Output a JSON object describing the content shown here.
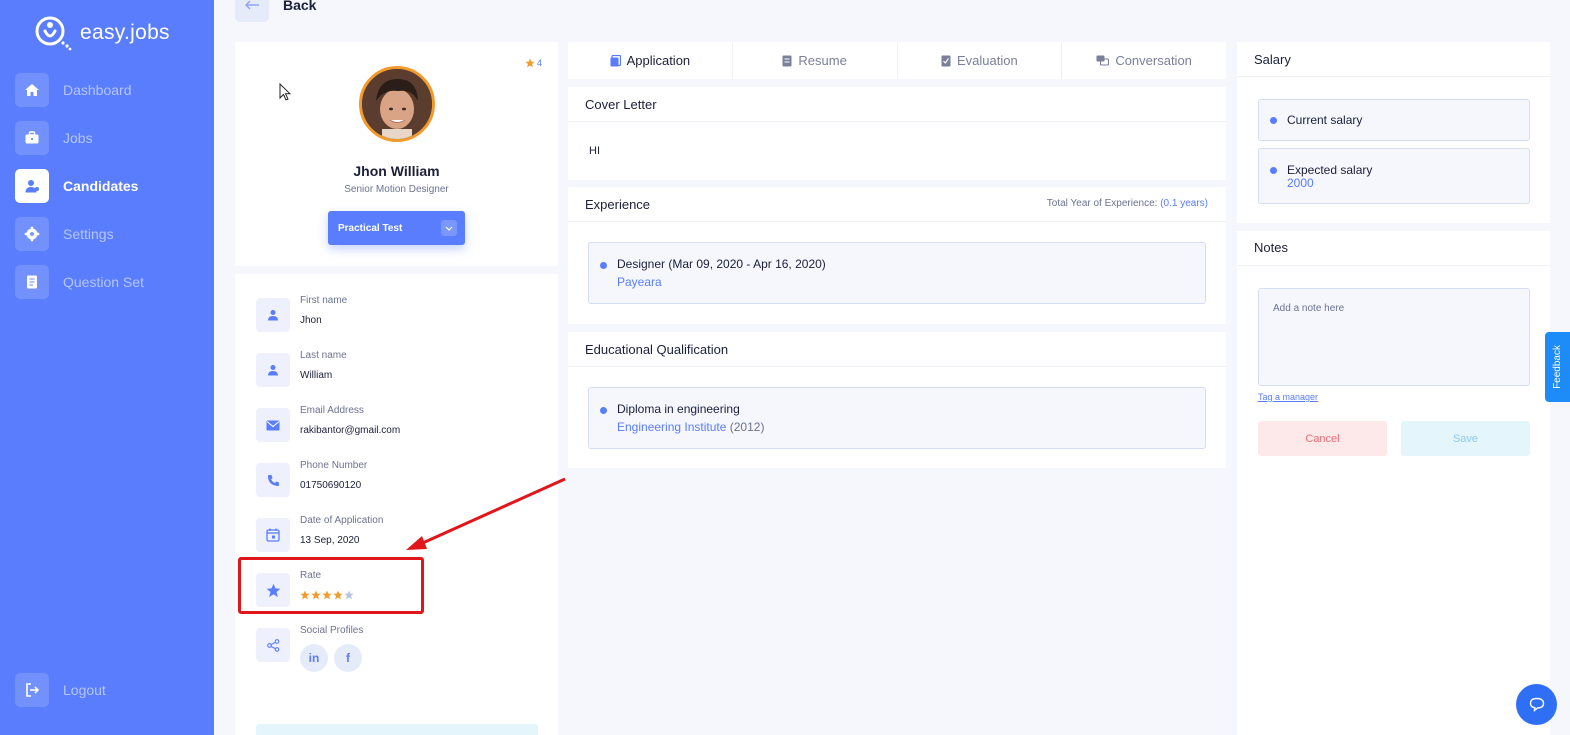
{
  "app": {
    "logo_text": "easy.jobs"
  },
  "sidebar": {
    "items": [
      {
        "label": "Dashboard",
        "icon": "home-icon"
      },
      {
        "label": "Jobs",
        "icon": "briefcase-icon"
      },
      {
        "label": "Candidates",
        "icon": "user-icon",
        "active": true
      },
      {
        "label": "Settings",
        "icon": "gear-icon"
      },
      {
        "label": "Question Set",
        "icon": "document-icon"
      }
    ],
    "logout_label": "Logout"
  },
  "topbar": {
    "back_label": "Back"
  },
  "candidate": {
    "rating_count": "4",
    "name": "Jhon William",
    "role": "Senior Motion Designer",
    "stage_label": "Practical Test",
    "rating": 4,
    "rating_max": 5,
    "fields": {
      "first_name_label": "First name",
      "first_name": "Jhon",
      "last_name_label": "Last name",
      "last_name": "William",
      "email_label": "Email Address",
      "email": "rakibantor@gmail.com",
      "phone_label": "Phone Number",
      "phone": "01750690120",
      "date_label": "Date of Application",
      "date": "13 Sep, 2020",
      "rate_label": "Rate",
      "social_label": "Social Profiles"
    },
    "social": {
      "linkedin": "in",
      "facebook": "f"
    }
  },
  "tabs": [
    {
      "label": "Application",
      "icon": "application-icon",
      "active": true
    },
    {
      "label": "Resume",
      "icon": "resume-icon"
    },
    {
      "label": "Evaluation",
      "icon": "evaluation-icon"
    },
    {
      "label": "Conversation",
      "icon": "conversation-icon"
    }
  ],
  "cover_letter": {
    "title": "Cover Letter",
    "text": "HI"
  },
  "experience": {
    "title": "Experience",
    "total_label": "Total Year of Experience:",
    "total_value": "(0.1 years)",
    "items": [
      {
        "title": "Designer (Mar 09, 2020 - Apr 16, 2020)",
        "company": "Payeara"
      }
    ]
  },
  "education": {
    "title": "Educational Qualification",
    "items": [
      {
        "title": "Diploma in engineering",
        "institute": "Engineering Institute",
        "year": "(2012)"
      }
    ]
  },
  "salary": {
    "title": "Salary",
    "current_label": "Current salary",
    "expected_label": "Expected salary",
    "expected_value": "2000"
  },
  "notes": {
    "title": "Notes",
    "placeholder": "Add a note here",
    "tag_link": "Tag a manager",
    "cancel_label": "Cancel",
    "save_label": "Save"
  },
  "feedback": {
    "label": "Feedback"
  },
  "colors": {
    "primary": "#597dfc",
    "star": "#f29b2c",
    "highlight": "#e0161b"
  }
}
